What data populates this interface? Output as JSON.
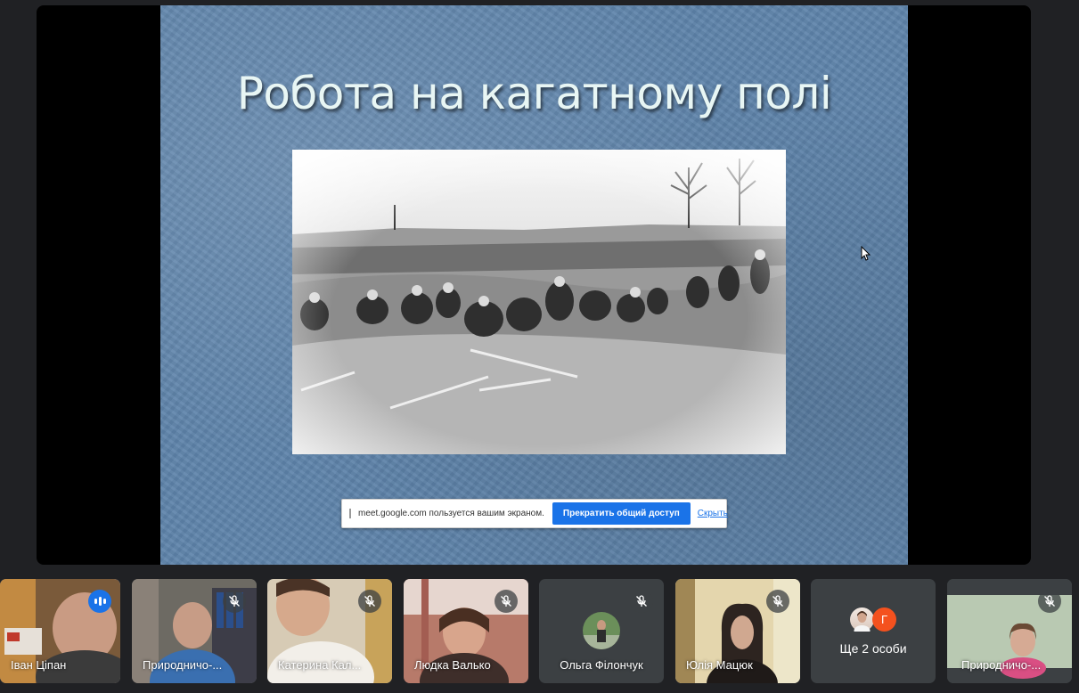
{
  "presentation": {
    "slide_title": "Робота на кагатному полі"
  },
  "share_notice": {
    "text": "meet.google.com пользуется вашим экраном.",
    "stop_label": "Прекратить общий доступ",
    "hide_label": "Скрыть"
  },
  "participants": [
    {
      "name": "Іван Ціпан",
      "speaking": true,
      "muted": false
    },
    {
      "name": "Природничо-...",
      "speaking": false,
      "muted": true
    },
    {
      "name": "Катерина Кал...",
      "speaking": false,
      "muted": true
    },
    {
      "name": "Людка Валько",
      "speaking": false,
      "muted": true
    },
    {
      "name": "Ольга Філончук",
      "speaking": false,
      "muted": true
    },
    {
      "name": "Юлія Мацюк",
      "speaking": false,
      "muted": true
    },
    {
      "name": "Природничо-...",
      "speaking": false,
      "muted": true
    }
  ],
  "more_people": {
    "label": "Ще 2 особи",
    "avatar_letter": "Г"
  },
  "colors": {
    "accent": "#1a73e8",
    "slide_bg": "#5f84ab",
    "letter_avatar": "#f4511e"
  }
}
